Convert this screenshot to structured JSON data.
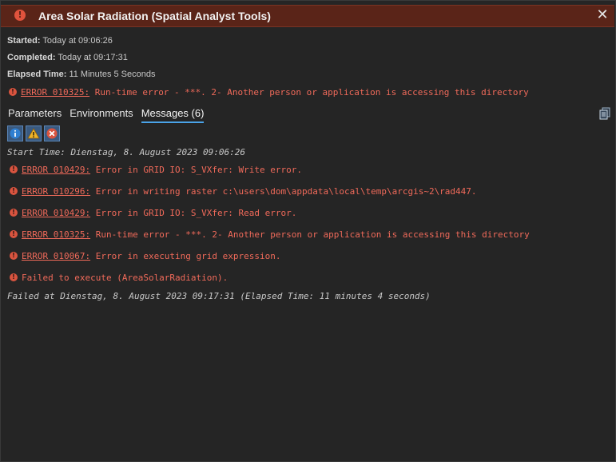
{
  "titlebar": {
    "title": "Area Solar Radiation (Spatial Analyst Tools)",
    "close_label": "✕"
  },
  "meta": {
    "started_label": "Started:",
    "started_value": "Today at 09:06:26",
    "completed_label": "Completed:",
    "completed_value": "Today at 09:17:31",
    "elapsed_label": "Elapsed Time:",
    "elapsed_value": "11 Minutes 5 Seconds"
  },
  "summary_error": {
    "code": "ERROR 010325:",
    "text": "Run-time error - ***. 2- Another person or application is accessing this directory"
  },
  "tabs": [
    {
      "label": "Parameters",
      "active": false
    },
    {
      "label": "Environments",
      "active": false
    },
    {
      "label": "Messages (6)",
      "active": true
    }
  ],
  "filters": [
    {
      "name": "info-filter",
      "icon": "info-icon"
    },
    {
      "name": "warning-filter",
      "icon": "warning-icon"
    },
    {
      "name": "error-filter",
      "icon": "error-icon"
    }
  ],
  "messages": {
    "start_time": "Start Time: Dienstag, 8. August 2023 09:06:26",
    "errors": [
      {
        "code": "ERROR 010429:",
        "text": "Error in GRID IO: S_VXfer: Write error."
      },
      {
        "code": "ERROR 010296:",
        "text": "Error in writing raster c:\\users\\dom\\appdata\\local\\temp\\arcgis~2\\rad447."
      },
      {
        "code": "ERROR 010429:",
        "text": "Error in GRID IO: S_VXfer: Read error."
      },
      {
        "code": "ERROR 010325:",
        "text": "Run-time error - ***. 2- Another person or application is accessing this directory"
      },
      {
        "code": "ERROR 010067:",
        "text": "Error in executing grid expression."
      },
      {
        "code": "",
        "text": "Failed to execute (AreaSolarRadiation)."
      }
    ],
    "failed_at": "Failed at Dienstag, 8. August 2023 09:17:31 (Elapsed Time: 11 minutes 4 seconds)"
  },
  "colors": {
    "title_bar": "#5a2418",
    "error_text": "#f06a5a",
    "tab_underline": "#4aa3e8",
    "background": "#252525"
  }
}
